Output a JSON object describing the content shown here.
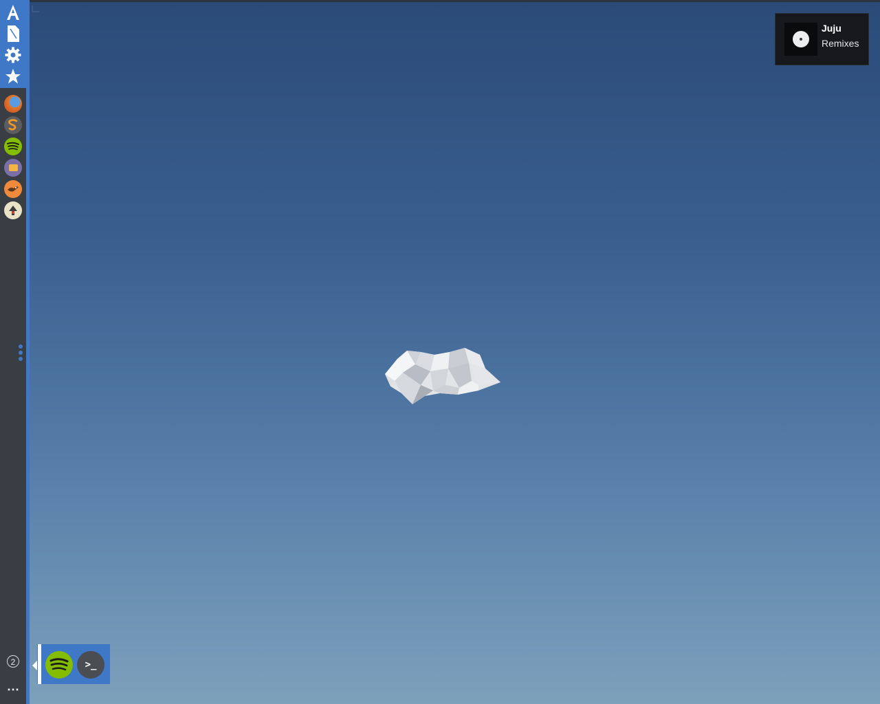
{
  "dock": {
    "launchers": [
      {
        "name": "apps",
        "icon": "app-store-icon"
      },
      {
        "name": "files",
        "icon": "document-icon"
      },
      {
        "name": "settings",
        "icon": "gear-icon"
      },
      {
        "name": "favorites",
        "icon": "star-icon"
      }
    ],
    "apps": [
      {
        "name": "firefox",
        "icon": "firefox-icon",
        "color": "#d2532f"
      },
      {
        "name": "sublime-text",
        "icon": "sublime-icon",
        "color": "#5b5d60"
      },
      {
        "name": "spotify",
        "icon": "spotify-icon",
        "color": "#84bd00"
      },
      {
        "name": "file-manager",
        "icon": "folder-icon",
        "color": "#7b6fa8"
      },
      {
        "name": "bird-app",
        "icon": "bird-icon",
        "color": "#ef8a3c"
      },
      {
        "name": "inkscape",
        "icon": "inkscape-icon",
        "color": "#e9e4c8"
      }
    ],
    "workspace_count": "2",
    "more_label": "⋯",
    "accent_color": "#3e78c6"
  },
  "notification": {
    "title": "Juju",
    "body": "Remixes",
    "icon": "album-art-icon"
  },
  "switcher": {
    "items": [
      {
        "name": "spotify",
        "icon": "spotify-icon"
      },
      {
        "name": "terminal",
        "icon": "terminal-icon",
        "glyph": ">_"
      }
    ]
  }
}
